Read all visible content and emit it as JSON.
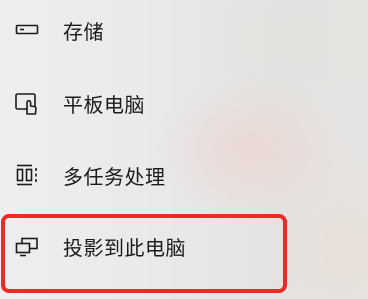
{
  "nav": {
    "items": [
      {
        "label": "存储",
        "icon": "storage-icon"
      },
      {
        "label": "平板电脑",
        "icon": "tablet-icon"
      },
      {
        "label": "多任务处理",
        "icon": "multitasking-icon"
      },
      {
        "label": "投影到此电脑",
        "icon": "project-to-pc-icon"
      }
    ]
  },
  "annotation": {
    "highlight_color": "#ee2a24",
    "highlighted_item": "投影到此电脑"
  }
}
